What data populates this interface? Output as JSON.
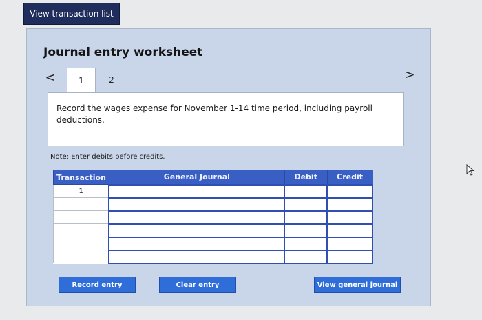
{
  "top": {
    "view_list_label": "View transaction list"
  },
  "worksheet": {
    "title": "Journal entry worksheet",
    "tabs": [
      {
        "label": "1",
        "active": true
      },
      {
        "label": "2",
        "active": false
      }
    ],
    "prev_icon": "<",
    "next_icon": ">",
    "instruction": "Record the wages expense for November 1-14 time period, including payroll deductions.",
    "note": "Note: Enter debits before credits."
  },
  "table": {
    "headers": [
      "Transaction",
      "General Journal",
      "Debit",
      "Credit"
    ],
    "rows": [
      {
        "transaction": "1"
      },
      {
        "transaction": ""
      },
      {
        "transaction": ""
      },
      {
        "transaction": ""
      },
      {
        "transaction": ""
      },
      {
        "transaction": ""
      }
    ]
  },
  "buttons": {
    "record": "Record entry",
    "clear": "Clear entry",
    "view_journal": "View general journal"
  },
  "colors": {
    "accent": "#2f6dd9",
    "header": "#3a5fc4",
    "panel": "#c9d6ea",
    "nav_dark": "#1f2d5c"
  }
}
